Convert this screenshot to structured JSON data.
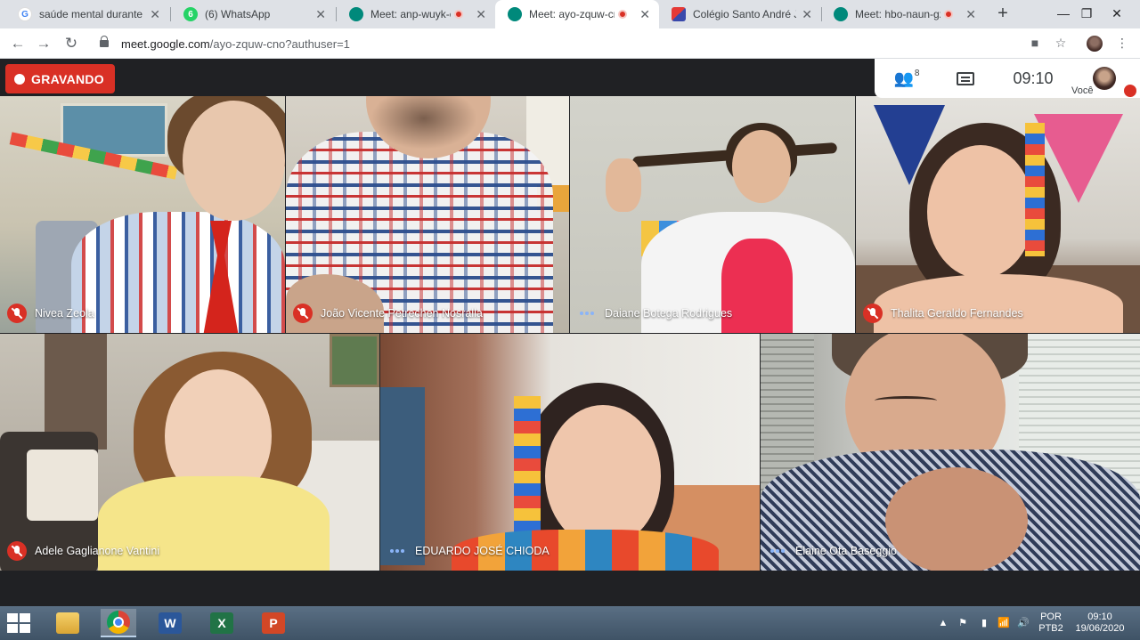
{
  "browser": {
    "tabs": [
      {
        "title": "saúde mental durante a",
        "favicon": "google-icon",
        "favicon_color": "#4285f4",
        "favicon_char": "G",
        "recording": false,
        "active": false
      },
      {
        "title": "(6) WhatsApp",
        "favicon": "whatsapp-icon",
        "favicon_color": "#25d366",
        "favicon_char": "6",
        "recording": false,
        "active": false
      },
      {
        "title": "Meet: anp-wuyk-cxu",
        "favicon": "meet-icon",
        "favicon_color": "#00897b",
        "favicon_char": "",
        "recording": true,
        "active": false
      },
      {
        "title": "Meet: ayo-zquw-cno",
        "favicon": "meet-icon",
        "favicon_color": "#00897b",
        "favicon_char": "",
        "recording": true,
        "active": true
      },
      {
        "title": "Colégio Santo André Jab",
        "favicon": "school-icon",
        "favicon_color": "#7e57c2",
        "favicon_char": "",
        "recording": false,
        "active": false
      },
      {
        "title": "Meet: hbo-naun-gz",
        "favicon": "meet-icon",
        "favicon_color": "#00897b",
        "favicon_char": "",
        "recording": true,
        "active": false
      }
    ],
    "new_tab": "+",
    "window_controls": {
      "minimize": "—",
      "maximize": "❐",
      "close": "✕"
    },
    "nav": {
      "back": "←",
      "forward": "→",
      "reload": "↻"
    },
    "url_host": "meet.google.com",
    "url_path": "/ayo-zquw-cno?authuser=1",
    "toolbar_icons": {
      "camera": "■",
      "bookmark": "☆",
      "menu": "⋮"
    }
  },
  "meet": {
    "recording_label": "GRAVANDO",
    "participant_count": "8",
    "time": "09:10",
    "self_label": "Você",
    "accent_red": "#d93025",
    "speaking_color": "#8ab4f8",
    "tiles": [
      {
        "name": "Nivea Zeola",
        "audio": "muted"
      },
      {
        "name": "João Vicente Petrechen Nosralla",
        "audio": "muted"
      },
      {
        "name": "Daiane Botega Rodrigues",
        "audio": "speaking"
      },
      {
        "name": "Thalita Geraldo Fernandes",
        "audio": "muted"
      },
      {
        "name": "Adele Gaglianone Vantini",
        "audio": "muted"
      },
      {
        "name": "EDUARDO JOSÉ CHIODA",
        "audio": "speaking"
      },
      {
        "name": "Elaine Ota Baseggio",
        "audio": "speaking"
      }
    ]
  },
  "taskbar": {
    "apps": [
      {
        "name": "file-explorer",
        "label": ""
      },
      {
        "name": "chrome",
        "label": ""
      },
      {
        "name": "word",
        "label": "W"
      },
      {
        "name": "excel",
        "label": "X"
      },
      {
        "name": "powerpoint",
        "label": "P"
      }
    ],
    "language_top": "POR",
    "language_bottom": "PTB2",
    "time": "09:10",
    "date": "19/06/2020"
  }
}
